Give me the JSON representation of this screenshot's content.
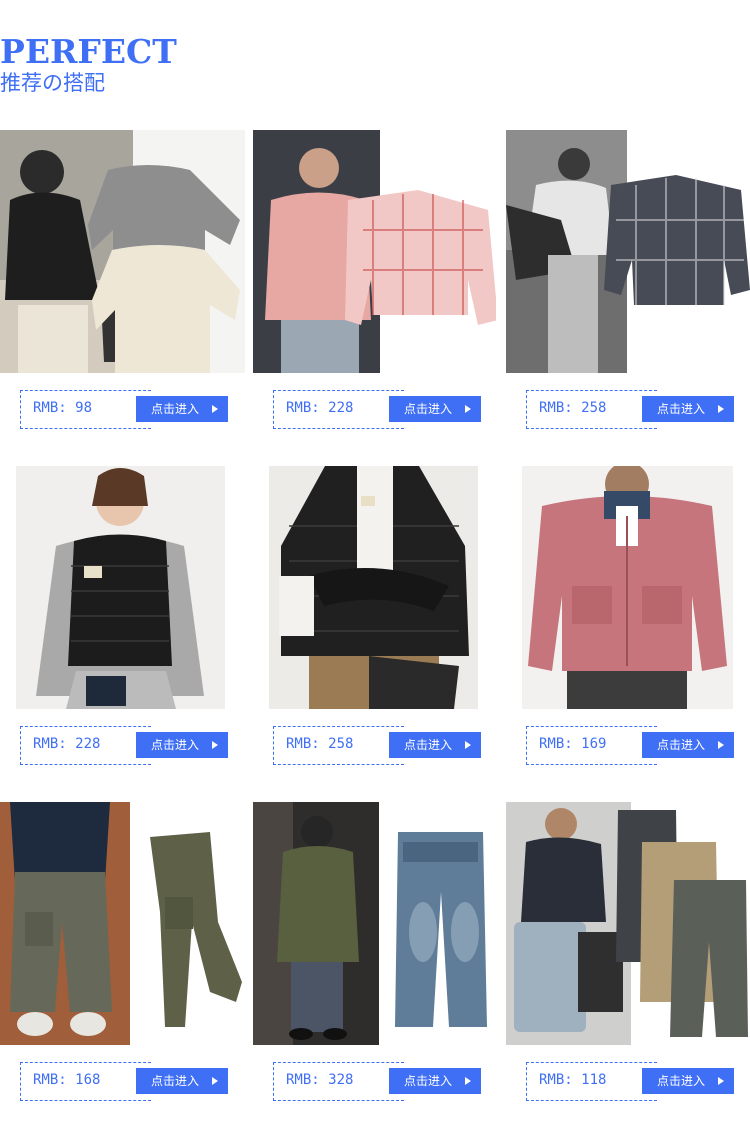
{
  "header": {
    "title": "PERFECT",
    "subtitle": "推荐の搭配"
  },
  "products": [
    {
      "price": "RMB: 98",
      "cta": "点击进入",
      "image": "sweaters-outfit"
    },
    {
      "price": "RMB: 228",
      "cta": "点击进入",
      "image": "pink-plaid-shirt"
    },
    {
      "price": "RMB: 258",
      "cta": "点击进入",
      "image": "black-plaid-shirt"
    },
    {
      "price": "RMB: 228",
      "cta": "点击进入",
      "image": "down-vest"
    },
    {
      "price": "RMB: 258",
      "cta": "点击进入",
      "image": "down-jacket"
    },
    {
      "price": "RMB: 169",
      "cta": "点击进入",
      "image": "pink-jacket"
    },
    {
      "price": "RMB: 168",
      "cta": "点击进入",
      "image": "cargo-pants"
    },
    {
      "price": "RMB: 328",
      "cta": "点击进入",
      "image": "denim-jeans"
    },
    {
      "price": "RMB: 118",
      "cta": "点击进入",
      "image": "easy-pants"
    }
  ],
  "colors": {
    "accent": "#3f6ff5"
  },
  "icons": {
    "button": "caret-right-icon"
  }
}
